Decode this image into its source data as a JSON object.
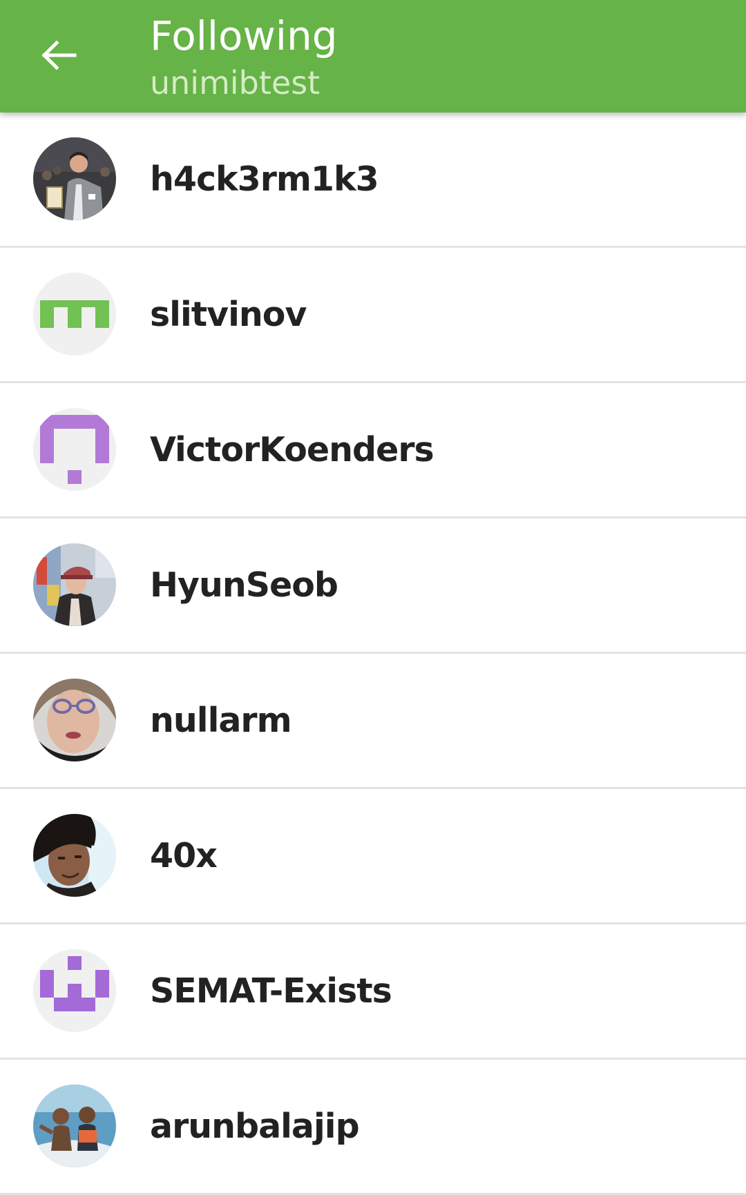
{
  "header": {
    "back_icon": "arrow-left-icon",
    "title": "Following",
    "subtitle": "unimibtest",
    "background_color": "#66b347"
  },
  "users": [
    {
      "name": "h4ck3rm1k3",
      "avatar": "photo"
    },
    {
      "name": "slitvinov",
      "avatar": "identicon-green"
    },
    {
      "name": "VictorKoenders",
      "avatar": "identicon-purple"
    },
    {
      "name": "HyunSeob",
      "avatar": "photo"
    },
    {
      "name": "nullarm",
      "avatar": "photo"
    },
    {
      "name": "40x",
      "avatar": "photo"
    },
    {
      "name": "SEMAT-Exists",
      "avatar": "identicon-purple"
    },
    {
      "name": "arunbalajip",
      "avatar": "photo"
    }
  ]
}
